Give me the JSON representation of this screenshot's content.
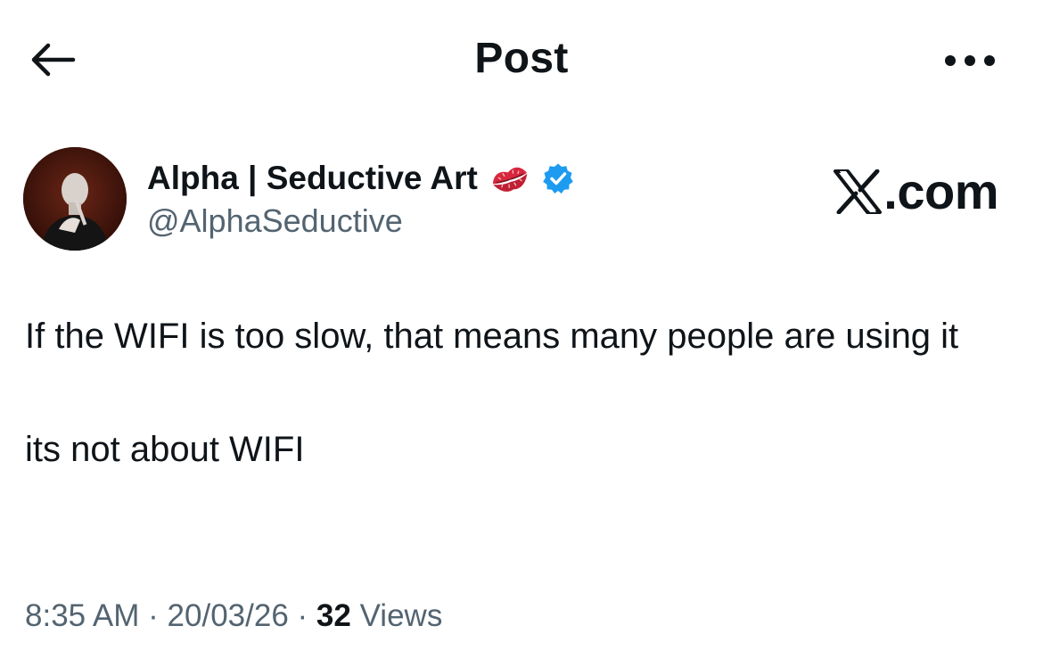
{
  "header": {
    "title": "Post",
    "back_icon": "arrow-left-icon",
    "more_icon": "more-horizontal-icon"
  },
  "post": {
    "author": {
      "name": "Alpha | Seductive Art",
      "handle": "@AlphaSeductive",
      "emoji_icon": "kiss-mark-icon",
      "verified_icon": "verified-badge-icon",
      "verified_color": "#1d9bf0"
    },
    "brand": {
      "logo_icon": "x-logo-icon",
      "text": ".com"
    },
    "text": {
      "line1": "If the WIFI is too slow, that means many people are using it",
      "line2": "its not about WIFI"
    },
    "meta": {
      "time": "8:35 AM",
      "sep1": "·",
      "date": "20/03/26",
      "sep2": "·",
      "views_count": "32",
      "views_label": "Views"
    }
  },
  "colors": {
    "text_primary": "#0f1419",
    "text_secondary": "#536471",
    "accent": "#1d9bf0",
    "lips": "#d7263d"
  }
}
